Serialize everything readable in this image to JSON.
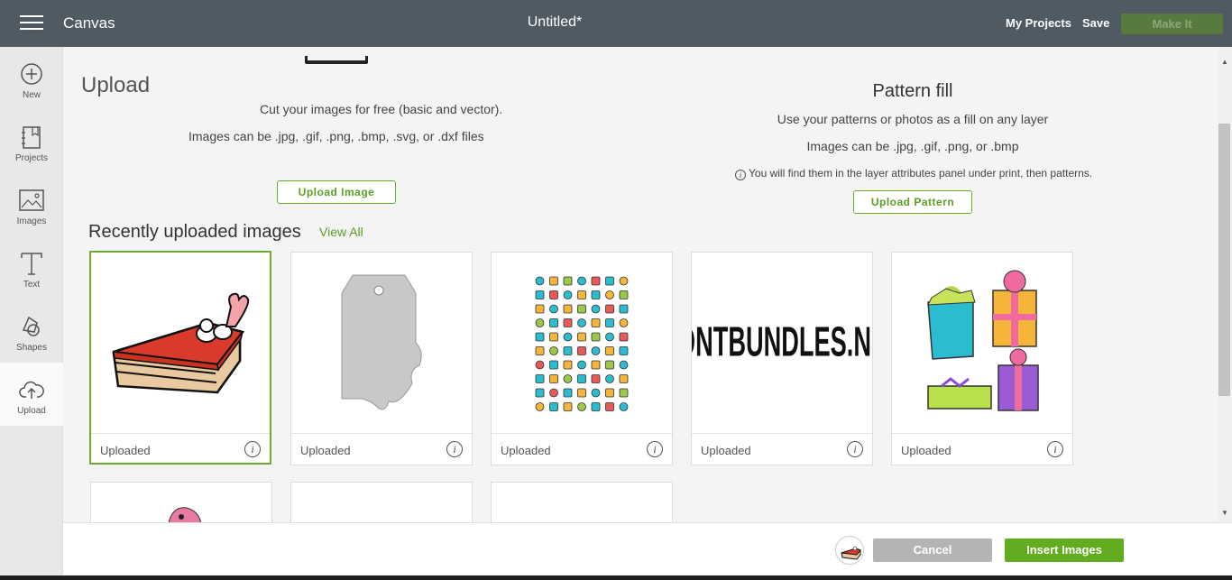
{
  "header": {
    "app_title": "Canvas",
    "doc_title": "Untitled*",
    "my_projects": "My Projects",
    "save": "Save",
    "make_it": "Make It"
  },
  "sidebar": {
    "items": [
      {
        "label": "New",
        "icon": "plus-circle-icon"
      },
      {
        "label": "Projects",
        "icon": "projects-icon"
      },
      {
        "label": "Images",
        "icon": "image-icon"
      },
      {
        "label": "Text",
        "icon": "text-icon"
      },
      {
        "label": "Shapes",
        "icon": "shapes-icon"
      },
      {
        "label": "Upload",
        "icon": "cloud-upload-icon"
      }
    ]
  },
  "upload": {
    "heading": "Upload",
    "cut_text": "Cut your images for free (basic and vector).",
    "files_text": "Images can be .jpg, .gif, .png, .bmp, .svg, or .dxf files",
    "button": "Upload Image"
  },
  "pattern": {
    "heading": "Pattern fill",
    "use_text": "Use your patterns or photos as a fill on any layer",
    "files_text": "Images can be .jpg, .gif, .png, or .bmp",
    "note": "You will find them in the layer attributes panel under print, then patterns.",
    "button": "Upload Pattern"
  },
  "recent": {
    "heading": "Recently uploaded images",
    "view_all": "View All",
    "tiles": [
      {
        "caption": "Uploaded",
        "image": "cake-slice"
      },
      {
        "caption": "Uploaded",
        "image": "gift-tag"
      },
      {
        "caption": "Uploaded",
        "image": "icon-grid"
      },
      {
        "caption": "Uploaded",
        "image": "fontbundles-logo",
        "logo_text": "FONTBUNDLES.NET"
      },
      {
        "caption": "Uploaded",
        "image": "gift-boxes"
      }
    ]
  },
  "footer": {
    "cancel": "Cancel",
    "insert": "Insert Images"
  },
  "colors": {
    "accent": "#62ac1f",
    "header_bg": "#4f5a62"
  }
}
